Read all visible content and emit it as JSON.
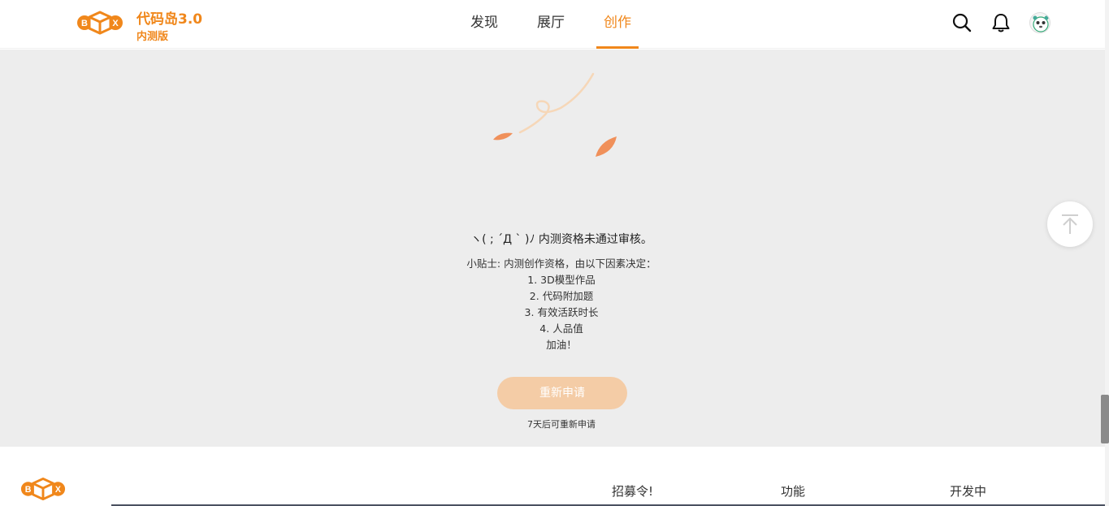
{
  "brand": {
    "title": "代码岛3.0",
    "subtitle": "内测版"
  },
  "nav": {
    "items": [
      {
        "label": "发现"
      },
      {
        "label": "展厅"
      },
      {
        "label": "创作"
      }
    ],
    "active_index": 2
  },
  "header_icons": [
    "search-icon",
    "bell-icon",
    "avatar"
  ],
  "main": {
    "title": "ヽ( ; ´Д ` )ﾉ 内测资格未通过审核。",
    "tips_heading": "小贴士: 内测创作资格，由以下因素决定：",
    "tips": [
      "1. 3D模型作品",
      "2. 代码附加题",
      "3. 有效活跃时长",
      "4. 人品值"
    ],
    "cheer": "加油！",
    "reapply_button": "重新申请",
    "reapply_note": "7天后可重新申请"
  },
  "footer": {
    "columns": [
      "招募令!",
      "功能",
      "开发中"
    ]
  },
  "colors": {
    "accent": "#f0871b",
    "background_gray": "#ededed",
    "button_disabled": "#f4cca6"
  }
}
